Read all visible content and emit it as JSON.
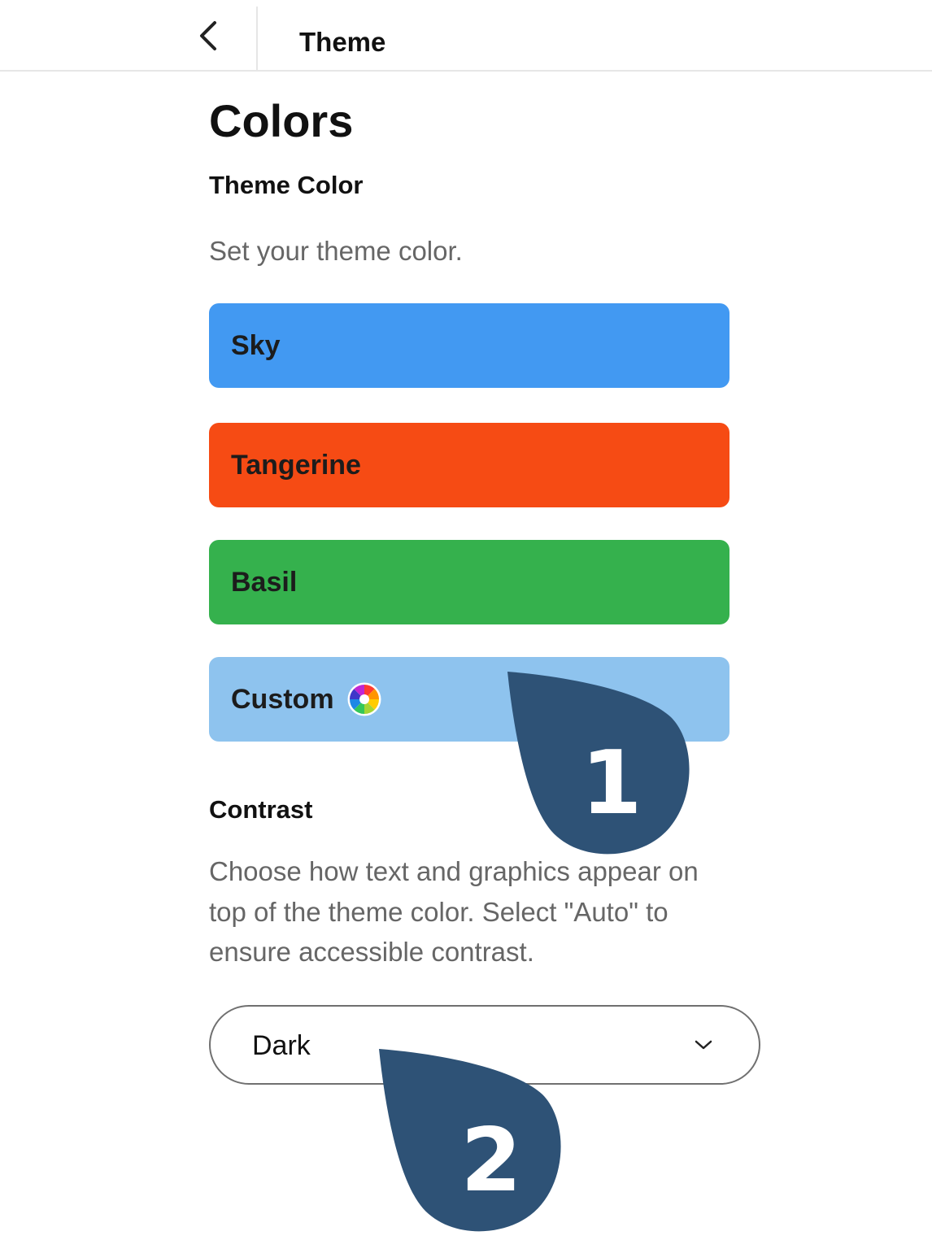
{
  "header": {
    "back_icon": "chevron-left-icon",
    "title": "Theme"
  },
  "page": {
    "title": "Colors"
  },
  "theme_color": {
    "heading": "Theme Color",
    "description": "Set your theme color.",
    "options": [
      {
        "label": "Sky",
        "color": "#4299f2"
      },
      {
        "label": "Tangerine",
        "color": "#f64b14"
      },
      {
        "label": "Basil",
        "color": "#35b14d"
      },
      {
        "label": "Custom",
        "color": "#8ec3ee",
        "icon": "color-wheel-icon"
      }
    ]
  },
  "contrast": {
    "heading": "Contrast",
    "description_lines": [
      "Choose how text and graphics appear on",
      "top of the theme color. Select \"Auto\" to",
      "ensure accessible contrast."
    ],
    "select_value": "Dark",
    "select_icon": "chevron-down-icon"
  },
  "callouts": [
    {
      "number": "1",
      "color": "#2e5276"
    },
    {
      "number": "2",
      "color": "#2e5276"
    }
  ]
}
